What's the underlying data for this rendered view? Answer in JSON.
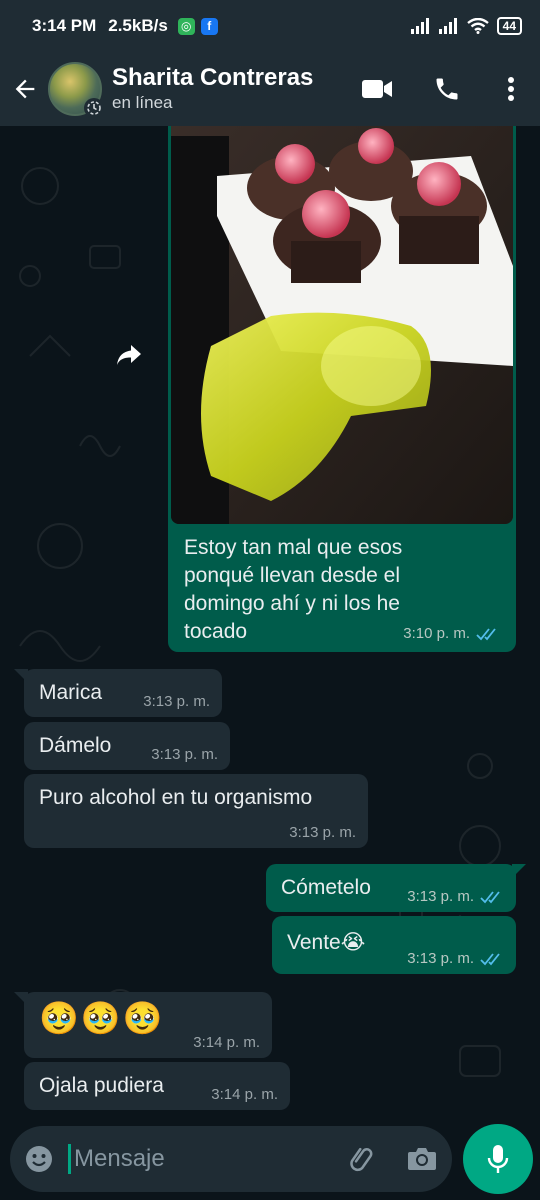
{
  "status_bar": {
    "time": "3:14 PM",
    "speed": "2.5kB/s",
    "battery": "44"
  },
  "header": {
    "contact_name": "Sharita Contreras",
    "contact_status": "en línea"
  },
  "messages": [
    {
      "dir": "out",
      "type": "image",
      "text": "Estoy tan mal que esos ponqué llevan desde el domingo ahí y ni los he tocado",
      "lines": [
        "Estoy tan mal que esos",
        "ponqué llevan desde el",
        "domingo ahí y ni los he",
        "tocado"
      ],
      "time": "3:10 p. m."
    },
    {
      "dir": "in",
      "text": "Marica",
      "time": "3:13 p. m."
    },
    {
      "dir": "in",
      "text": "Dámelo",
      "time": "3:13 p. m."
    },
    {
      "dir": "in",
      "text": "Puro alcohol en tu organismo",
      "time": "3:13 p. m."
    },
    {
      "dir": "out",
      "text": "Cómetelo",
      "time": "3:13 p. m."
    },
    {
      "dir": "out",
      "text": "Vente😭",
      "time": "3:13 p. m."
    },
    {
      "dir": "in",
      "text": "🥹🥹🥹",
      "time": "3:14 p. m."
    },
    {
      "dir": "in",
      "text": "Ojala pudiera",
      "time": "3:14 p. m."
    }
  ],
  "composer": {
    "placeholder": "Mensaje"
  },
  "colors": {
    "outgoing_bubble": "#005c4b",
    "incoming_bubble": "#1f2c34",
    "accent": "#00a884",
    "read_ticks": "#53bdeb"
  }
}
